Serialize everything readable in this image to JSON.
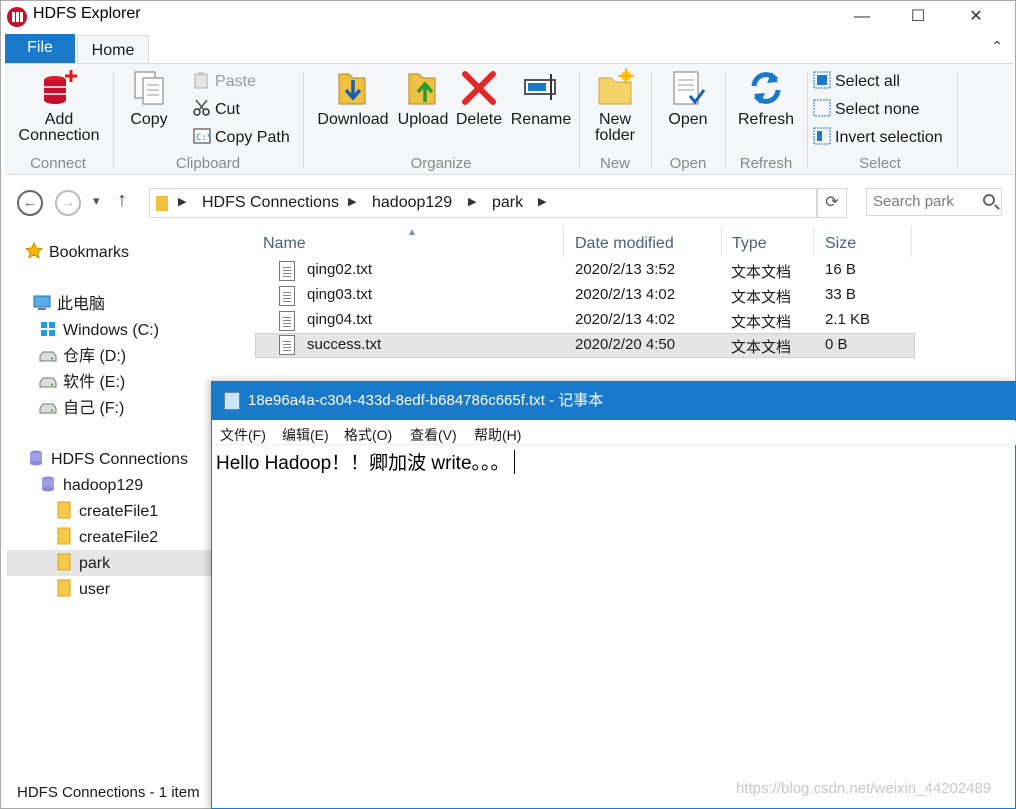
{
  "window": {
    "title": "HDFS Explorer",
    "minimize_label": "—",
    "maximize_label": "☐",
    "close_label": "✕"
  },
  "ribbon": {
    "file_tab": "File",
    "home_tab": "Home",
    "collapse_label": "⌃",
    "groups": {
      "connect": "Connect",
      "clipboard": "Clipboard",
      "organize": "Organize",
      "new": "New",
      "open": "Open",
      "refresh": "Refresh",
      "select": "Select"
    },
    "add_connection_line1": "Add",
    "add_connection_line2": "Connection",
    "copy": "Copy",
    "paste": "Paste",
    "cut": "Cut",
    "copy_path": "Copy Path",
    "download": "Download",
    "upload": "Upload",
    "delete": "Delete",
    "rename": "Rename",
    "new_folder_line1": "New",
    "new_folder_line2": "folder",
    "open": "Open",
    "refresh": "Refresh",
    "select_all": "Select all",
    "select_none": "Select none",
    "invert_selection": "Invert selection"
  },
  "address": {
    "back": "←",
    "forward": "→",
    "recent": "▾",
    "up": "↑",
    "crumbs": [
      "HDFS Connections",
      "hadoop129",
      "park"
    ],
    "refresh": "⟳",
    "search_placeholder": "Search park"
  },
  "nav": {
    "bookmarks": "Bookmarks",
    "this_pc": "此电脑",
    "drives": [
      "Windows (C:)",
      "仓库 (D:)",
      "软件 (E:)",
      "自己 (F:)"
    ],
    "hdfs_connections": "HDFS Connections",
    "host": "hadoop129",
    "folders": [
      "createFile1",
      "createFile2",
      "park",
      "user"
    ]
  },
  "files": {
    "columns": [
      "Name",
      "Date modified",
      "Type",
      "Size"
    ],
    "rows": [
      {
        "name": "qing02.txt",
        "date": "2020/2/13 3:52",
        "type": "文本文档",
        "size": "16 B"
      },
      {
        "name": "qing03.txt",
        "date": "2020/2/13 4:02",
        "type": "文本文档",
        "size": "33 B"
      },
      {
        "name": "qing04.txt",
        "date": "2020/2/13 4:02",
        "type": "文本文档",
        "size": "2.1 KB"
      },
      {
        "name": "success.txt",
        "date": "2020/2/20 4:50",
        "type": "文本文档",
        "size": "0 B"
      }
    ]
  },
  "status": "HDFS Connections - 1 item",
  "notepad": {
    "title": "18e96a4a-c304-433d-8edf-b684786c665f.txt - 记事本",
    "menu": [
      "文件(F)",
      "编辑(E)",
      "格式(O)",
      "查看(V)",
      "帮助(H)"
    ],
    "content": "Hello Hadoop！！卿加波 write。。。"
  },
  "watermark": "https://blog.csdn.net/weixin_44202489",
  "colors": {
    "accent": "#1979ca",
    "ribbon_bg": "#f5f6f7",
    "group_label": "#8a8a8a",
    "header_text": "#4c607a",
    "selection": "#e5e5e5"
  }
}
